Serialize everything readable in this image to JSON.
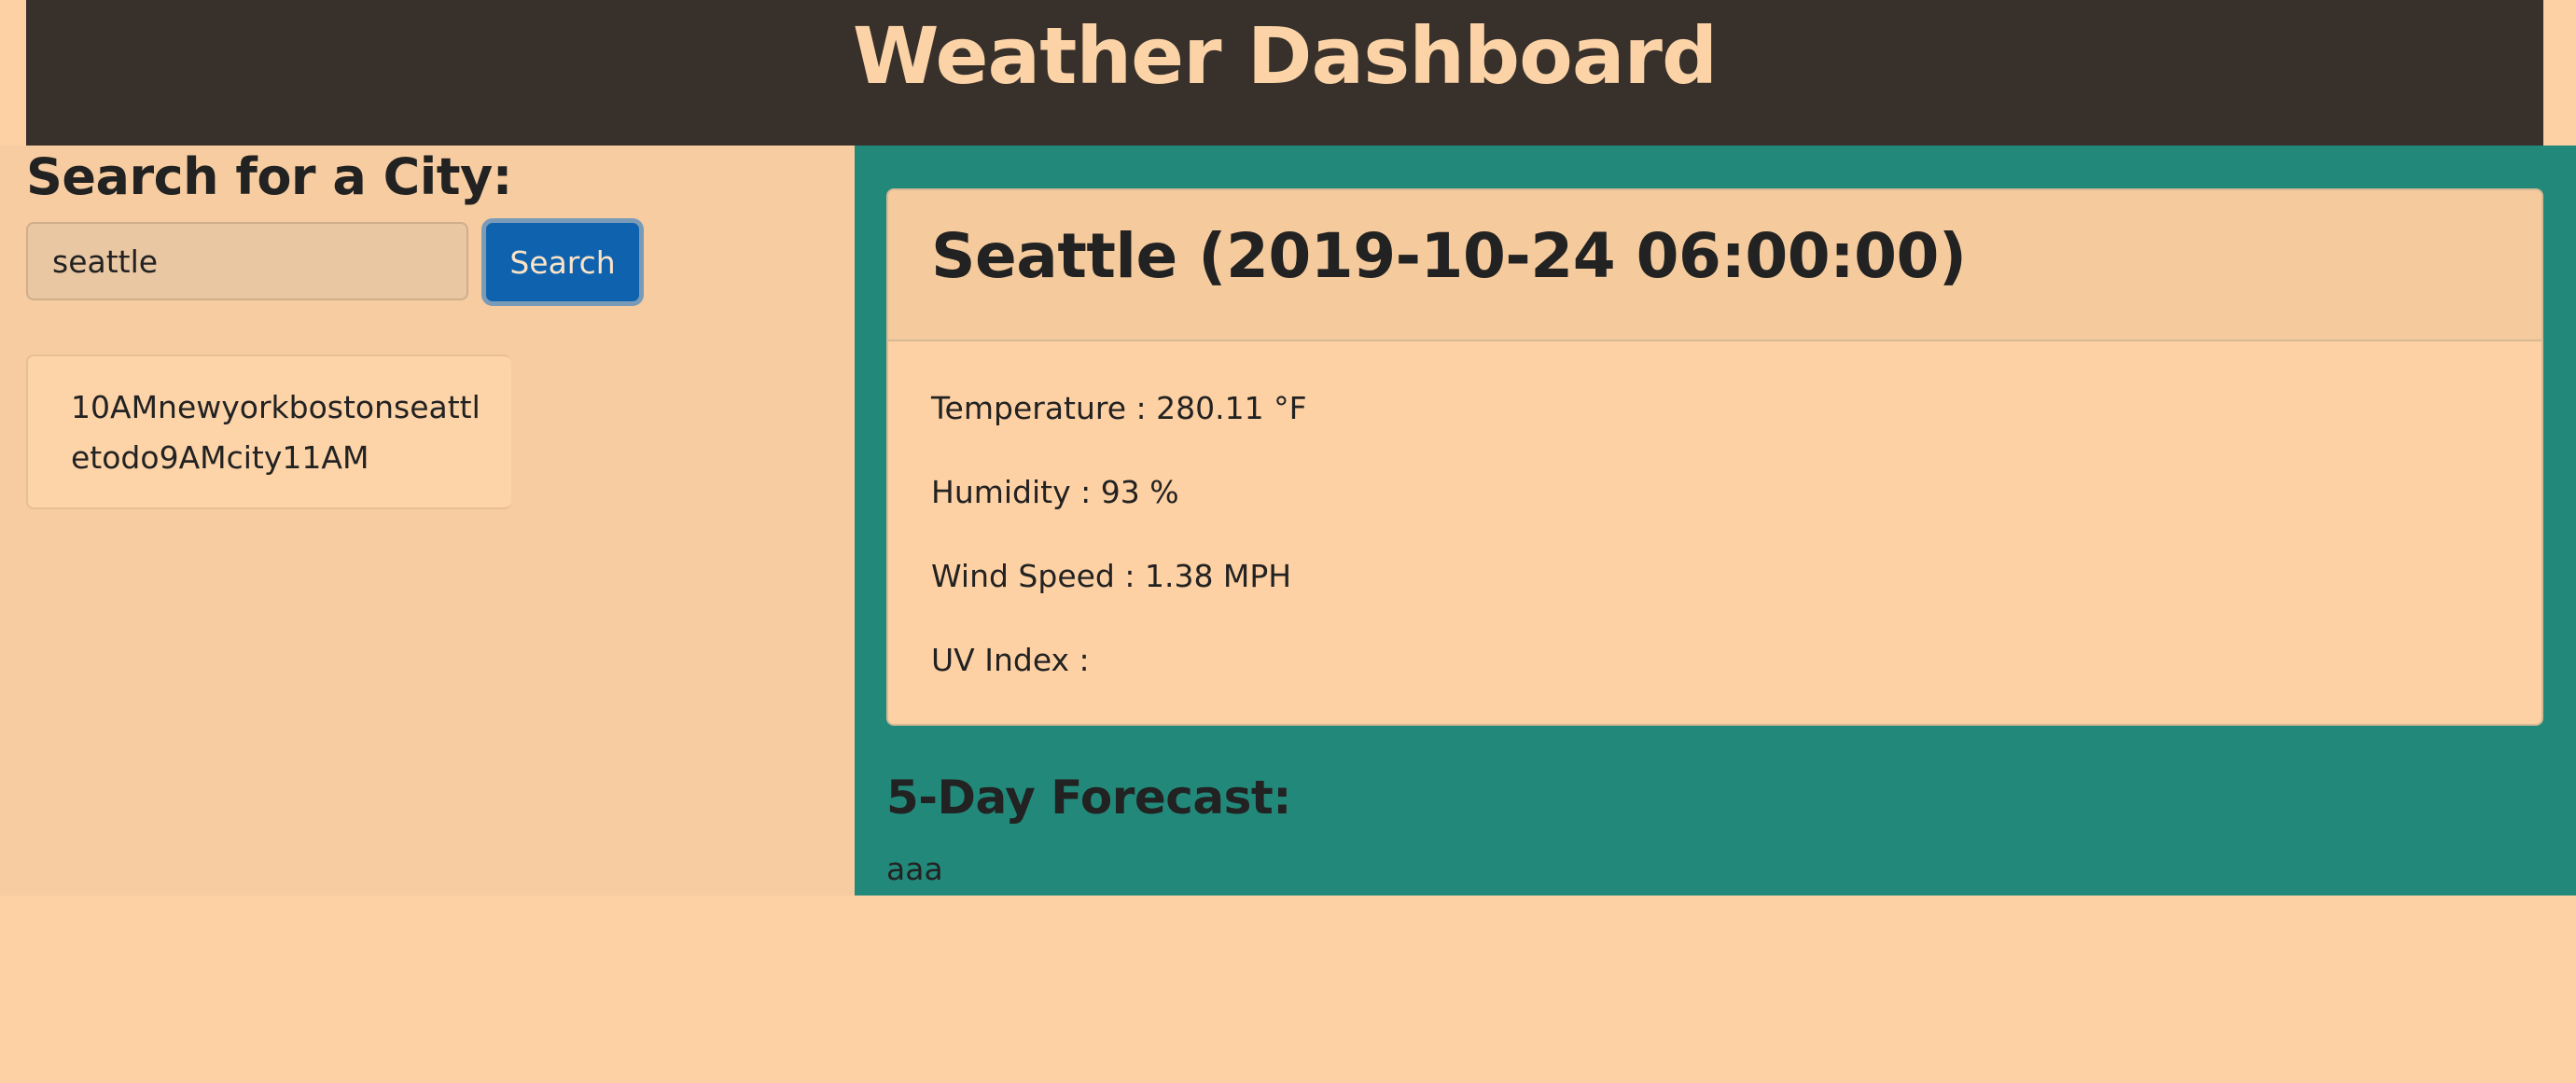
{
  "header": {
    "title": "Weather Dashboard"
  },
  "sidebar": {
    "heading": "Search for a City:",
    "search_value": "seattle",
    "search_button_label": "Search",
    "history_text": "10AMnewyorkbostonseattletodo9AMcity11AM"
  },
  "current": {
    "title": "Seattle (2019-10-24 06:00:00)",
    "temperature": "Temperature : 280.11 °F",
    "humidity": "Humidity : 93 %",
    "wind_speed": "Wind Speed : 1.38 MPH",
    "uv_index": "UV Index :"
  },
  "forecast": {
    "heading": "5-Day Forecast:",
    "content": "aaa"
  },
  "colors": {
    "page_bg": "#fed1a4",
    "header_bg": "#37302b",
    "header_text": "#fbd3a7",
    "sidebar_bg": "#f6cca0",
    "main_bg": "#22897a",
    "button_bg": "#0f63ae"
  }
}
